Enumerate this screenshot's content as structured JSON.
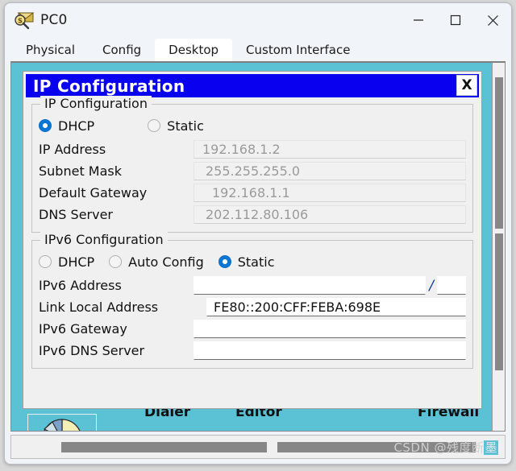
{
  "window": {
    "title": "PC0",
    "icon": "packet-inspect-icon",
    "controls": {
      "minimize": "minimize-icon",
      "maximize": "maximize-icon",
      "close": "close-icon"
    }
  },
  "tabs": [
    {
      "label": "Physical",
      "active": false
    },
    {
      "label": "Config",
      "active": false
    },
    {
      "label": "Desktop",
      "active": true
    },
    {
      "label": "Custom Interface",
      "active": false
    }
  ],
  "dialog": {
    "title": "IP Configuration",
    "close_label": "X",
    "ipv4": {
      "legend": "IP Configuration",
      "dhcp_label": "DHCP",
      "static_label": "Static",
      "selected": "dhcp",
      "fields": [
        {
          "label": "IP Address",
          "value": "192.168.1.2"
        },
        {
          "label": "Subnet Mask",
          "value": "255.255.255.0"
        },
        {
          "label": "Default Gateway",
          "value": "192.168.1.1"
        },
        {
          "label": "DNS Server",
          "value": "202.112.80.106"
        }
      ]
    },
    "ipv6": {
      "legend": "IPv6 Configuration",
      "dhcp_label": "DHCP",
      "auto_config_label": "Auto Config",
      "static_label": "Static",
      "selected": "static",
      "address_label": "IPv6 Address",
      "address_value": "",
      "prefix_separator": "/",
      "prefix_value": "",
      "link_local_label": "Link Local Address",
      "link_local_value": "FE80::200:CFF:FEBA:698E",
      "gateway_label": "IPv6 Gateway",
      "gateway_value": "",
      "dns_label": "IPv6 DNS Server",
      "dns_value": ""
    }
  },
  "desktop": {
    "background_color": "#5bc2d6",
    "labels": [
      "Dialer",
      "Editor",
      "Firewall"
    ],
    "icon_name": "pie-chart-icon"
  },
  "watermark": {
    "prefix": "CSDN @残度断",
    "highlight": "墨"
  }
}
